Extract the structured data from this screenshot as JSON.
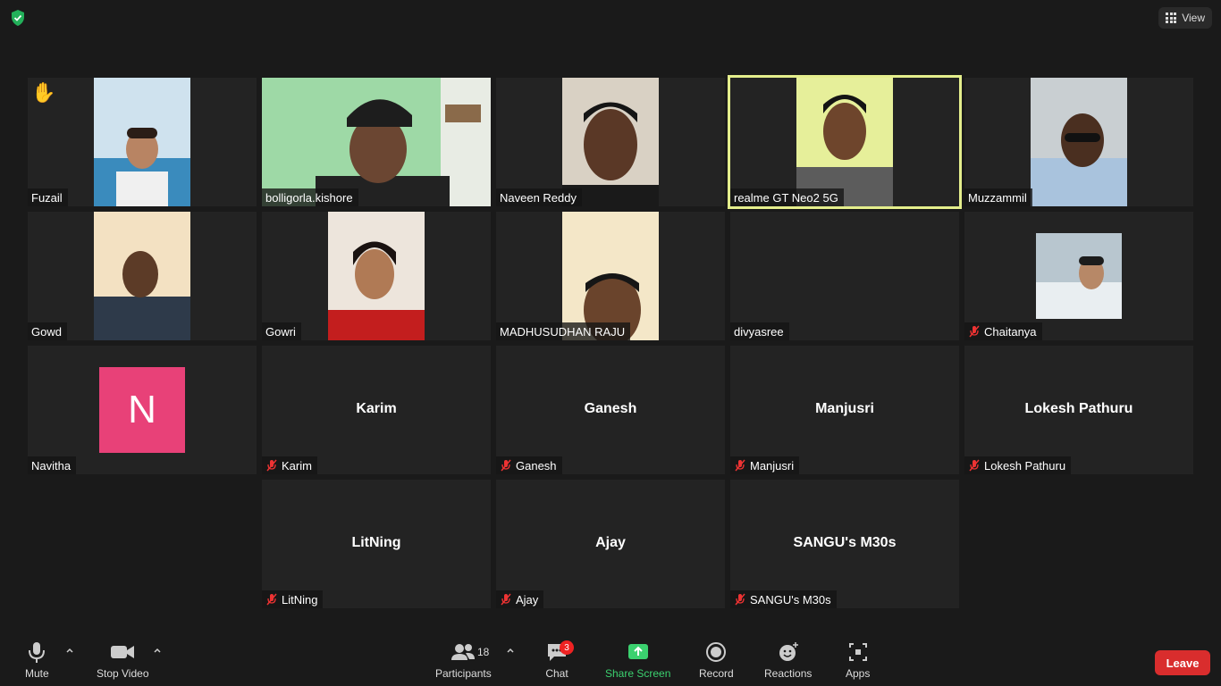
{
  "view_label": "View",
  "raised_hand": "✋",
  "tiles": [
    {
      "name": "Fuzail",
      "hand": true
    },
    {
      "name": "bolligorla.kishore"
    },
    {
      "name": "Naveen Reddy"
    },
    {
      "name": "realme GT Neo2 5G",
      "active": true
    },
    {
      "name": "Muzzammil"
    },
    {
      "name": "Gowd"
    },
    {
      "name": "Gowri"
    },
    {
      "name": "MADHUSUDHAN RAJU"
    },
    {
      "name": "divyasree"
    },
    {
      "name": "Chaitanya",
      "muted": true
    },
    {
      "name": "Navitha",
      "avatar_letter": "N"
    },
    {
      "name": "Karim",
      "big_name": "Karim",
      "muted": true
    },
    {
      "name": "Ganesh",
      "big_name": "Ganesh",
      "muted": true
    },
    {
      "name": "Manjusri",
      "big_name": "Manjusri",
      "muted": true
    },
    {
      "name": "Lokesh Pathuru",
      "big_name": "Lokesh Pathuru",
      "muted": true
    },
    {
      "name": "LitNing",
      "big_name": "LitNing",
      "muted": true
    },
    {
      "name": "Ajay",
      "big_name": "Ajay",
      "muted": true
    },
    {
      "name": "SANGU's M30s",
      "big_name": "SANGU's M30s",
      "muted": true
    }
  ],
  "toolbar": {
    "mute": "Mute",
    "stop_video": "Stop Video",
    "participants": "Participants",
    "participants_count": "18",
    "chat": "Chat",
    "chat_badge": "3",
    "share_screen": "Share Screen",
    "record": "Record",
    "reactions": "Reactions",
    "apps": "Apps",
    "leave": "Leave"
  },
  "colors": {
    "active_speaker": "#e4ee8c",
    "share_green": "#3bd16f",
    "leave_red": "#d92d2d",
    "avatar_pink": "#e84178",
    "muted_red": "#e33"
  }
}
